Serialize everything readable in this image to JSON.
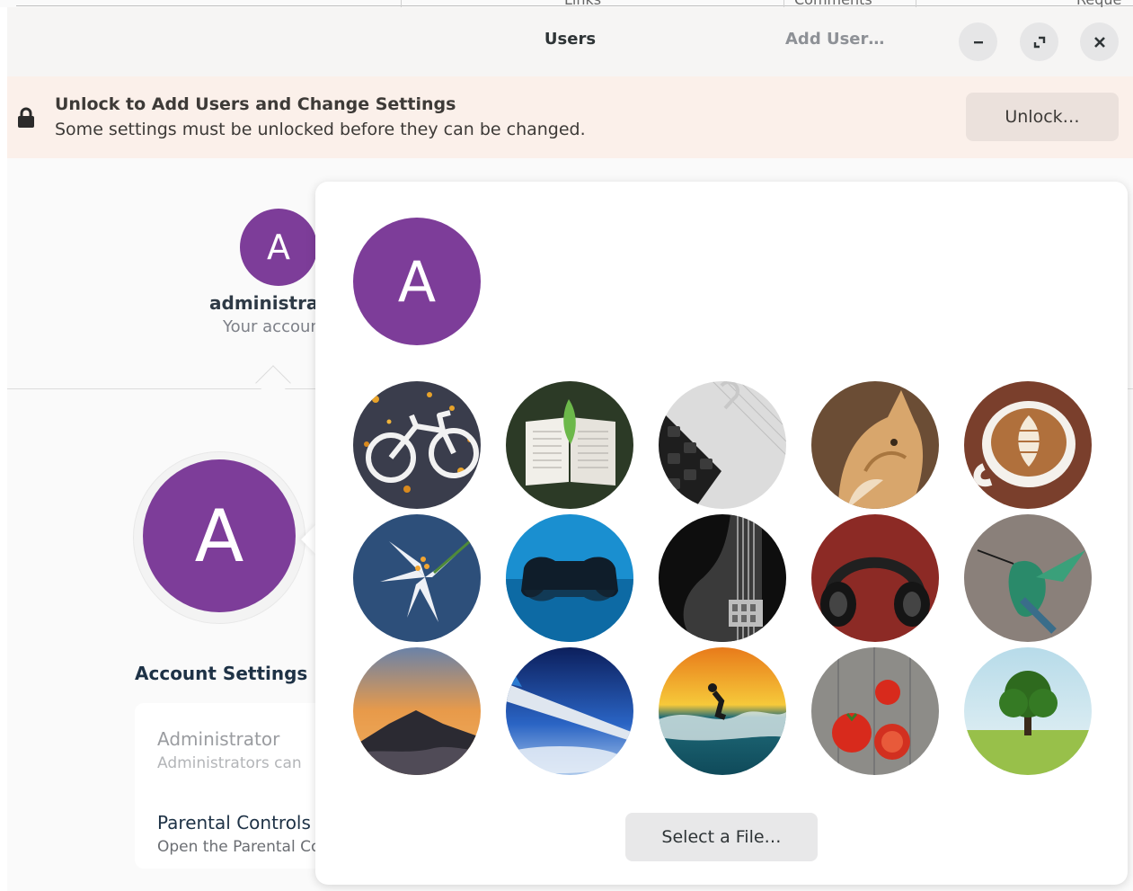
{
  "background_tabs": [
    "Links",
    "Comments",
    "Reque"
  ],
  "headerbar": {
    "title": "Users",
    "add_user_label": "Add User…"
  },
  "banner": {
    "title": "Unlock to Add Users and Change Settings",
    "subtitle": "Some settings must be unlocked before they can be changed.",
    "unlock_label": "Unlock…"
  },
  "user_switcher": {
    "initial": "A",
    "name": "administrator",
    "subtitle": "Your account"
  },
  "account": {
    "initial": "A",
    "heading": "Account Settings",
    "rows": [
      {
        "title": "Administrator",
        "subtitle": "Administrators can"
      },
      {
        "title": "Parental Controls",
        "subtitle": "Open the Parental Controls"
      }
    ]
  },
  "avatar_popover": {
    "current_initial": "A",
    "avatar_options": [
      "bicycle",
      "book",
      "calculator",
      "cat",
      "coffee",
      "flower",
      "gamepad",
      "guitar",
      "headphones",
      "hummingbird",
      "mountain",
      "plane",
      "surfer",
      "tomatoes",
      "tree"
    ],
    "select_file_label": "Select a File…"
  },
  "colors": {
    "avatar_purple": "#7d3d99",
    "banner_bg": "#fbf0ea",
    "window_bg": "#fafafa"
  }
}
